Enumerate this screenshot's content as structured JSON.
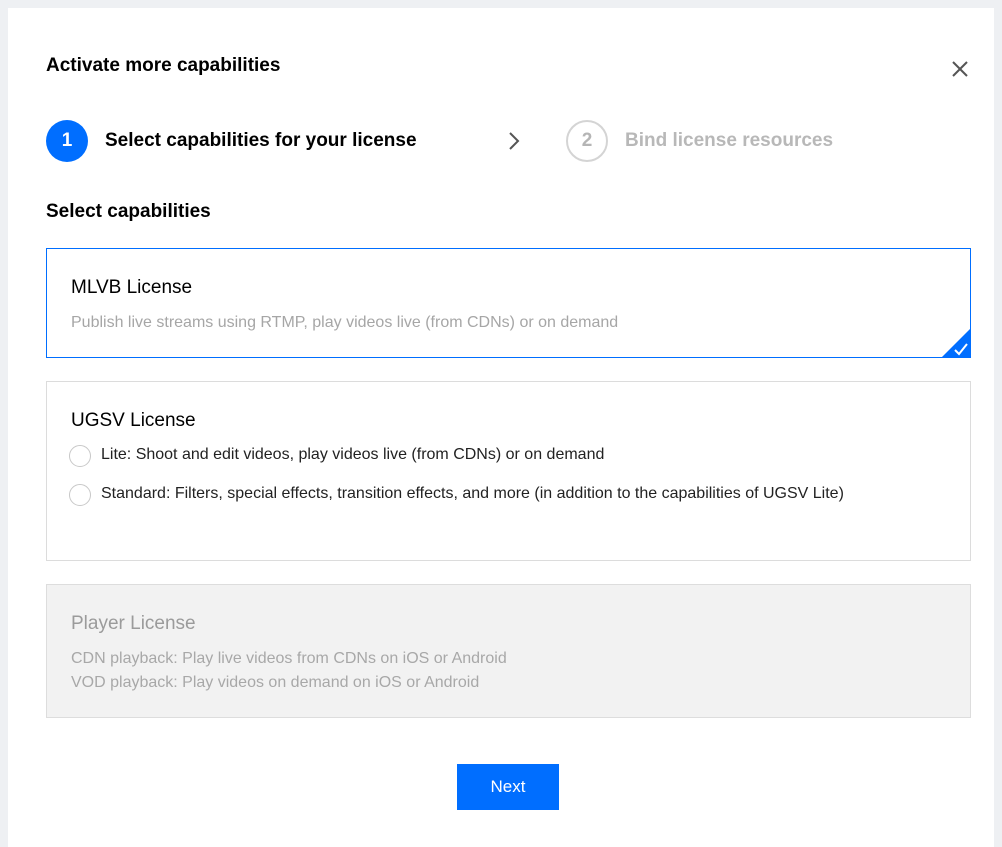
{
  "dialog": {
    "title": "Activate more capabilities"
  },
  "steps": [
    {
      "number": "1",
      "label": "Select capabilities for your license",
      "state": "active"
    },
    {
      "number": "2",
      "label": "Bind license resources",
      "state": "inactive"
    }
  ],
  "section": {
    "title": "Select capabilities"
  },
  "cards": {
    "mlvb": {
      "title": "MLVB License",
      "description": "Publish live streams using RTMP, play videos live (from CDNs) or on demand",
      "selected": true
    },
    "ugsv": {
      "title": "UGSV License",
      "options": [
        {
          "label": "Lite: Shoot and edit videos, play videos live (from CDNs) or on demand",
          "checked": false
        },
        {
          "label": "Standard: Filters, special effects, transition effects, and more (in addition to the capabilities of UGSV Lite)",
          "checked": false
        }
      ]
    },
    "player": {
      "title": "Player License",
      "lines": [
        "CDN playback: Play live videos from CDNs on iOS or Android",
        "VOD playback: Play videos on demand on iOS or Android"
      ],
      "disabled": true
    }
  },
  "footer": {
    "next_label": "Next"
  },
  "colors": {
    "primary": "#006eff",
    "disabled_bg": "#f2f2f2",
    "muted_text": "#a6a6a6"
  },
  "icons": {
    "close": "close-icon",
    "step_arrow": "chevron-right-icon",
    "selected": "checkmark-icon"
  }
}
